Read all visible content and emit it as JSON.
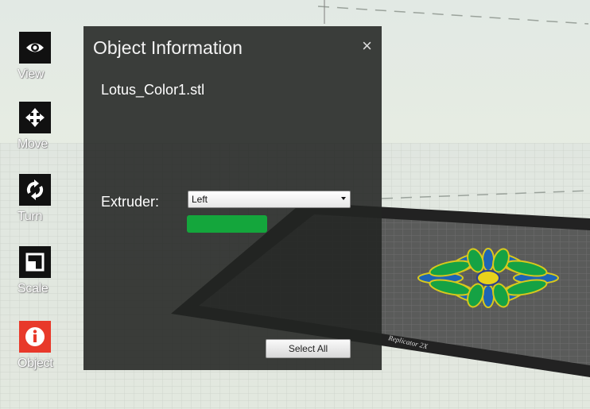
{
  "toolbar": {
    "items": [
      {
        "label": "View",
        "icon": "eye-icon"
      },
      {
        "label": "Move",
        "icon": "move-arrows-icon"
      },
      {
        "label": "Turn",
        "icon": "rotate-icon"
      },
      {
        "label": "Scale",
        "icon": "scale-icon"
      },
      {
        "label": "Object",
        "icon": "info-icon"
      }
    ],
    "active_color": "#e8392a"
  },
  "panel": {
    "title": "Object Information",
    "close_symbol": "×",
    "filename": "Lotus_Color1.stl",
    "extruder_label": "Extruder:",
    "extruder_value": "Left",
    "extruder_color": "#14a63c",
    "select_all_label": "Select All"
  },
  "scene": {
    "platform_label": "Replicator 2X"
  }
}
